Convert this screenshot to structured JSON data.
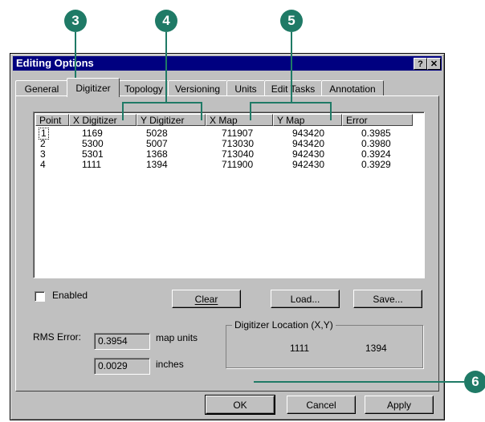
{
  "window": {
    "title": "Editing Options",
    "help_btn": "?",
    "close_btn": "✕"
  },
  "tabs": [
    "General",
    "Digitizer",
    "Topology",
    "Versioning",
    "Units",
    "Edit Tasks",
    "Annotation"
  ],
  "list": {
    "columns": [
      "Point",
      "X Digitizer",
      "Y Digitizer",
      "X Map",
      "Y Map",
      "Error"
    ],
    "rows": [
      [
        "1",
        "1169",
        "5028",
        "711907",
        "943420",
        "0.3985"
      ],
      [
        "2",
        "5300",
        "5007",
        "713030",
        "943420",
        "0.3980"
      ],
      [
        "3",
        "5301",
        "1368",
        "713040",
        "942430",
        "0.3924"
      ],
      [
        "4",
        "1111",
        "1394",
        "711900",
        "942430",
        "0.3929"
      ]
    ]
  },
  "enabled": {
    "label": "Enabled",
    "checked": false
  },
  "buttons": {
    "clear": "Clear",
    "load": "Load...",
    "save": "Save...",
    "ok": "OK",
    "cancel": "Cancel",
    "apply": "Apply"
  },
  "rms": {
    "label": "RMS Error:",
    "value1": "0.3954",
    "unit1": "map units",
    "value2": "0.0029",
    "unit2": "inches"
  },
  "location": {
    "title": "Digitizer Location (X,Y)",
    "x": "1111",
    "y": "1394"
  },
  "callouts": [
    "3",
    "4",
    "5",
    "6"
  ],
  "colors": {
    "title_bar": "#000080",
    "dialog": "#c0c0c0",
    "callout": "#1f7a66"
  }
}
